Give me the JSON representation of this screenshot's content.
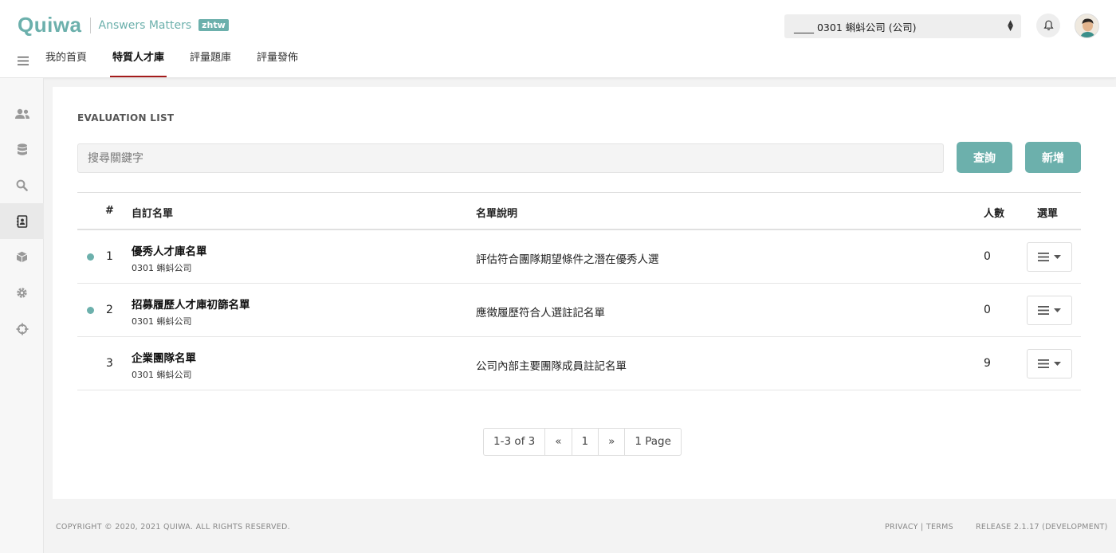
{
  "brand": {
    "logo": "Quiwa",
    "tagline": "Answers Matters",
    "lang": "zhtw"
  },
  "header": {
    "company_select": "____ 0301 蝌蚪公司 (公司)"
  },
  "nav": {
    "items": [
      "我的首頁",
      "特質人才庫",
      "評量題庫",
      "評量發佈"
    ],
    "active_index": 1
  },
  "sidebar": {
    "icons": [
      "users-icon",
      "database-icon",
      "search-icon",
      "contact-book-icon",
      "box-icon",
      "gear-icon",
      "crosshair-icon"
    ],
    "active_index": 3
  },
  "main": {
    "section_title": "EVALUATION LIST",
    "search_placeholder": "搜尋關鍵字",
    "query_button": "查詢",
    "add_button": "新增",
    "table": {
      "headers": [
        "#",
        "自訂名單",
        "名單說明",
        "人數",
        "選單"
      ],
      "rows": [
        {
          "num": "1",
          "name": "優秀人才庫名單",
          "company": "0301 蝌蚪公司",
          "desc": "評估符合團隊期望條件之潛在優秀人選",
          "count": "0",
          "dot": true
        },
        {
          "num": "2",
          "name": "招募履歷人才庫初篩名單",
          "company": "0301 蝌蚪公司",
          "desc": "應徵履歷符合人選註記名單",
          "count": "0",
          "dot": true
        },
        {
          "num": "3",
          "name": "企業團隊名單",
          "company": "0301 蝌蚪公司",
          "desc": "公司內部主要團隊成員註記名單",
          "count": "9",
          "dot": false
        }
      ]
    },
    "pagination": {
      "range": "1-3 of 3",
      "prev": "«",
      "current": "1",
      "next": "»",
      "total": "1 Page"
    }
  },
  "footer": {
    "copyright": "COPYRIGHT © 2020, 2021 QUIWA. ALL RIGHTS RESERVED.",
    "links": "PRIVACY | TERMS",
    "release": "RELEASE 2.1.17 (DEVELOPMENT)"
  },
  "colors": {
    "accent": "#6cb0ac",
    "nav_underline": "#a31b1b"
  }
}
